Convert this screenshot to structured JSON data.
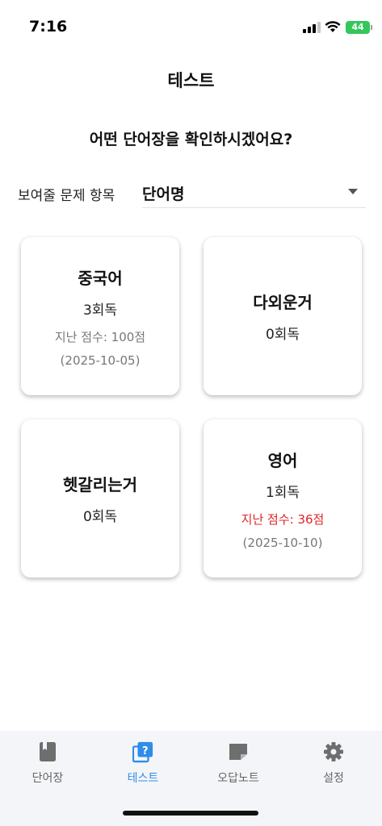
{
  "status_bar": {
    "time": "7:16",
    "battery": "44"
  },
  "header": {
    "title": "테스트"
  },
  "question": "어떤 단어장을 확인하시겠어요?",
  "question_field": {
    "label": "보여줄 문제 항목",
    "value": "단어명"
  },
  "cards": [
    {
      "title": "중국어",
      "count": "3회독",
      "score": "지난 점수: 100점",
      "date": "(2025-10-05)"
    },
    {
      "title": "다외운거",
      "count": "0회독"
    },
    {
      "title": "헷갈리는거",
      "count": "0회독"
    },
    {
      "title": "영어",
      "count": "1회독",
      "score": "지난 점수: 36점",
      "date": "(2025-10-10)"
    }
  ],
  "tabs": [
    {
      "label": "단어장",
      "icon": "book-icon"
    },
    {
      "label": "테스트",
      "icon": "quiz-icon",
      "active": true
    },
    {
      "label": "오답노트",
      "icon": "note-icon"
    },
    {
      "label": "설정",
      "icon": "gear-icon"
    }
  ],
  "colors": {
    "accent": "#2f8ce8",
    "warning": "#e02424",
    "battery": "#34c759"
  }
}
